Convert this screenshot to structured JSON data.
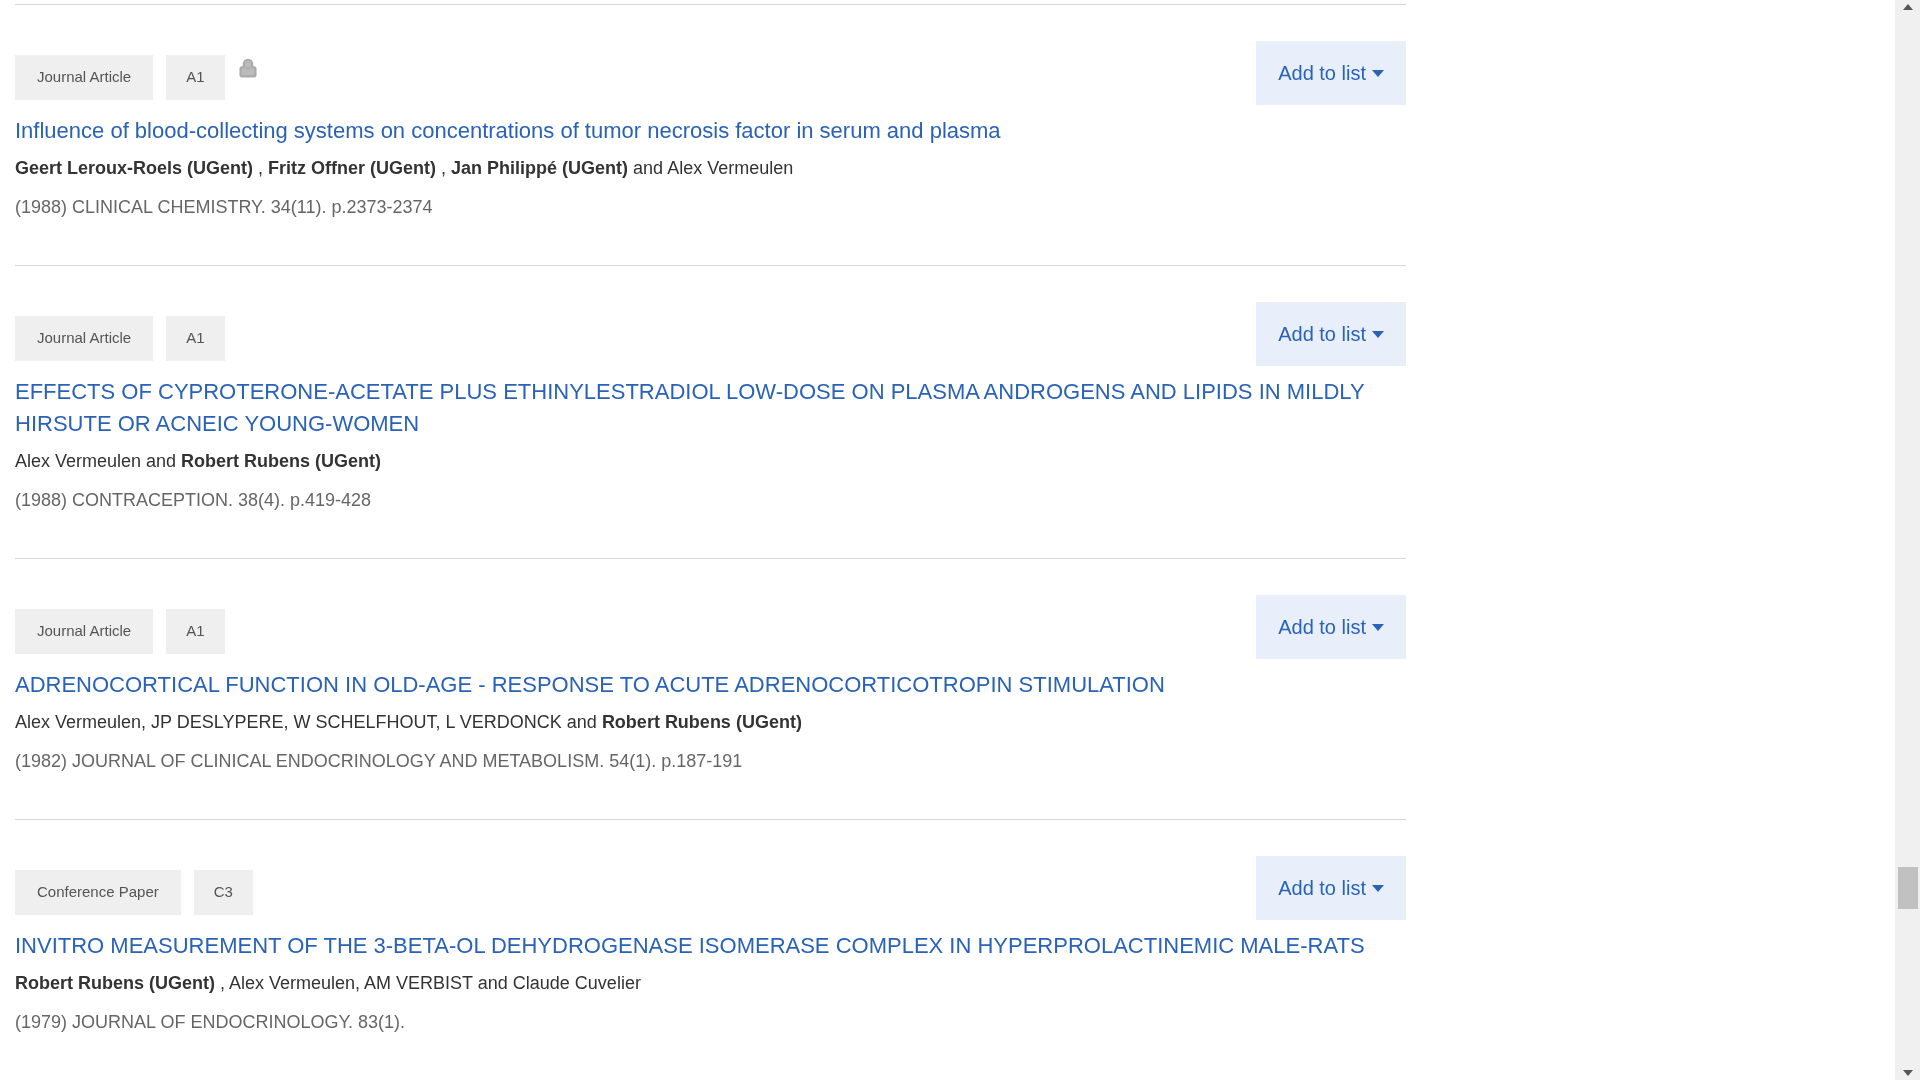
{
  "results": [
    {
      "type": "Journal Article",
      "classification": "A1",
      "locked": true,
      "button": "Add to list",
      "title": "Influence of blood-collecting systems on concentrations of tumor necrosis factor in serum and plasma",
      "authors": "**Geert Leroux-Roels (UGent)** , **Fritz Offner (UGent)** , **Jan Philippé (UGent)** and Alex Vermeulen",
      "citation": "(1988) CLINICAL CHEMISTRY. 34(11). p.2373-2374"
    },
    {
      "type": "Journal Article",
      "classification": "A1",
      "locked": false,
      "button": "Add to list",
      "title": "EFFECTS OF CYPROTERONE-ACETATE PLUS ETHINYLESTRADIOL LOW-DOSE ON PLASMA ANDROGENS AND LIPIDS IN MILDLY HIRSUTE OR ACNEIC YOUNG-WOMEN",
      "authors": "Alex Vermeulen and **Robert Rubens (UGent)**",
      "citation": "(1988) CONTRACEPTION. 38(4). p.419-428"
    },
    {
      "type": "Journal Article",
      "classification": "A1",
      "locked": false,
      "button": "Add to list",
      "title": "ADRENOCORTICAL FUNCTION IN OLD-AGE - RESPONSE TO ACUTE ADRENOCORTICOTROPIN STIMULATION",
      "authors": "Alex Vermeulen, JP DESLYPERE, W SCHELFHOUT, L VERDONCK and **Robert Rubens (UGent)**",
      "citation": "(1982) JOURNAL OF CLINICAL ENDOCRINOLOGY AND METABOLISM. 54(1). p.187-191"
    },
    {
      "type": "Conference Paper",
      "classification": "C3",
      "locked": false,
      "button": "Add to list",
      "title": "INVITRO MEASUREMENT OF THE 3-BETA-OL DEHYDROGENASE ISOMERASE COMPLEX IN HYPERPROLACTINEMIC MALE-RATS",
      "authors": "**Robert Rubens (UGent)** , Alex Vermeulen, AM VERBIST and Claude Cuvelier",
      "citation": "(1979) JOURNAL OF ENDOCRINOLOGY. 83(1)."
    }
  ]
}
